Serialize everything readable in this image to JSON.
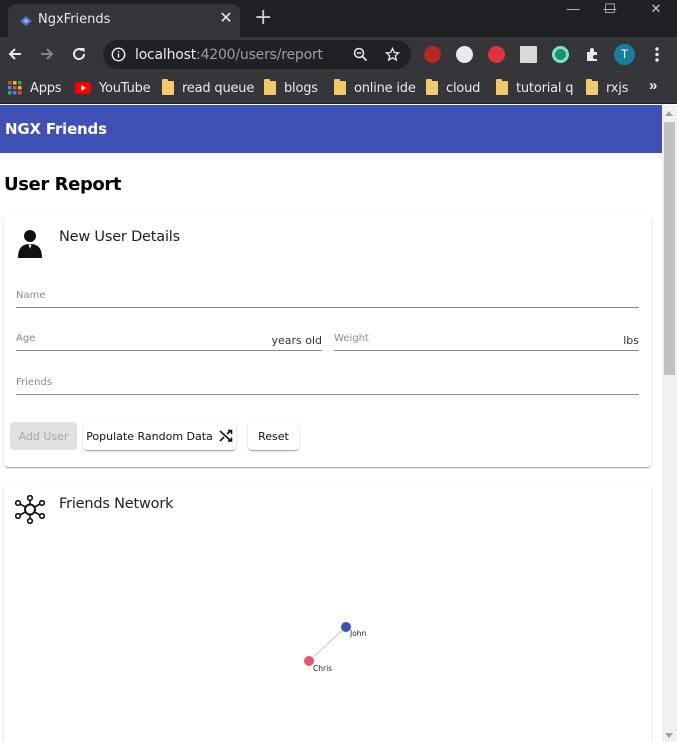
{
  "browser": {
    "tab_title": "NgxFriends",
    "tab_close": "✕",
    "new_tab": "+",
    "window": {
      "minimize": "—",
      "maximize": "☐",
      "close": "✕"
    },
    "url_host": "localhost",
    "url_rest": ":4200/users/report",
    "avatar_letter": "T",
    "bookmarks": [
      {
        "label": "Apps"
      },
      {
        "label": "YouTube"
      },
      {
        "label": "read queue"
      },
      {
        "label": "blogs"
      },
      {
        "label": "online ide"
      },
      {
        "label": "cloud"
      },
      {
        "label": "tutorial q"
      },
      {
        "label": "rxjs"
      }
    ],
    "bookmarks_more": "»"
  },
  "app": {
    "title": "NGX Friends",
    "page_title": "User Report",
    "primary_color": "#3f51b5"
  },
  "form": {
    "card_title": "New User Details",
    "name_placeholder": "Name",
    "age_placeholder": "Age",
    "age_suffix": "years old",
    "weight_placeholder": "Weight",
    "weight_suffix": "lbs",
    "friends_placeholder": "Friends",
    "add_user_label": "Add User",
    "populate_label": "Populate Random Data",
    "reset_label": "Reset"
  },
  "network": {
    "card_title": "Friends Network",
    "nodes": [
      {
        "name": "John",
        "color": "#3f51b5"
      },
      {
        "name": "Chris",
        "color": "#e8546c"
      }
    ],
    "links": [
      {
        "source": "John",
        "target": "Chris"
      }
    ]
  }
}
